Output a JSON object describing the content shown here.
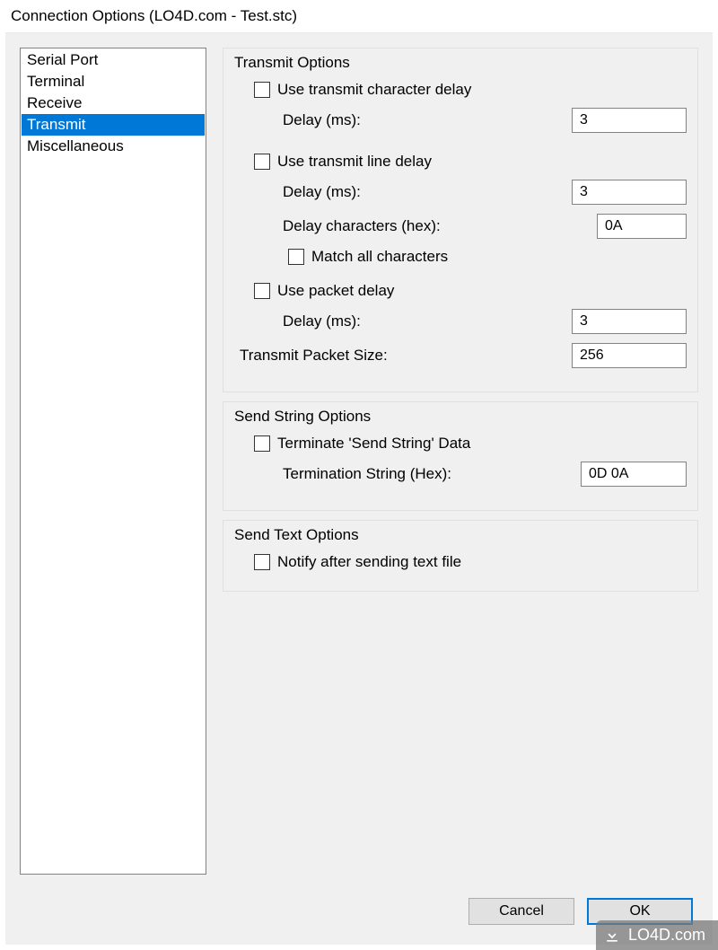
{
  "window": {
    "title": "Connection Options (LO4D.com - Test.stc)"
  },
  "sidebar": {
    "items": [
      {
        "label": "Serial Port",
        "selected": false
      },
      {
        "label": "Terminal",
        "selected": false
      },
      {
        "label": "Receive",
        "selected": false
      },
      {
        "label": "Transmit",
        "selected": true
      },
      {
        "label": "Miscellaneous",
        "selected": false
      }
    ]
  },
  "transmit": {
    "group_title": "Transmit Options",
    "char_delay": {
      "label": "Use transmit character delay",
      "checked": false,
      "delay_label": "Delay (ms):",
      "delay_value": "3"
    },
    "line_delay": {
      "label": "Use transmit line delay",
      "checked": false,
      "delay_label": "Delay (ms):",
      "delay_value": "3",
      "chars_label": "Delay characters (hex):",
      "chars_value": "0A",
      "match_all_label": "Match all characters",
      "match_all_checked": false
    },
    "packet_delay": {
      "label": "Use packet delay",
      "checked": false,
      "delay_label": "Delay (ms):",
      "delay_value": "3"
    },
    "packet_size": {
      "label": "Transmit Packet Size:",
      "value": "256"
    }
  },
  "send_string": {
    "group_title": "Send String Options",
    "terminate": {
      "label": "Terminate 'Send String' Data",
      "checked": false
    },
    "term_string": {
      "label": "Termination String (Hex):",
      "value": "0D 0A"
    }
  },
  "send_text": {
    "group_title": "Send Text Options",
    "notify": {
      "label": "Notify after sending text file",
      "checked": false
    }
  },
  "buttons": {
    "cancel": "Cancel",
    "ok": "OK"
  },
  "watermark": {
    "text": "LO4D.com"
  }
}
